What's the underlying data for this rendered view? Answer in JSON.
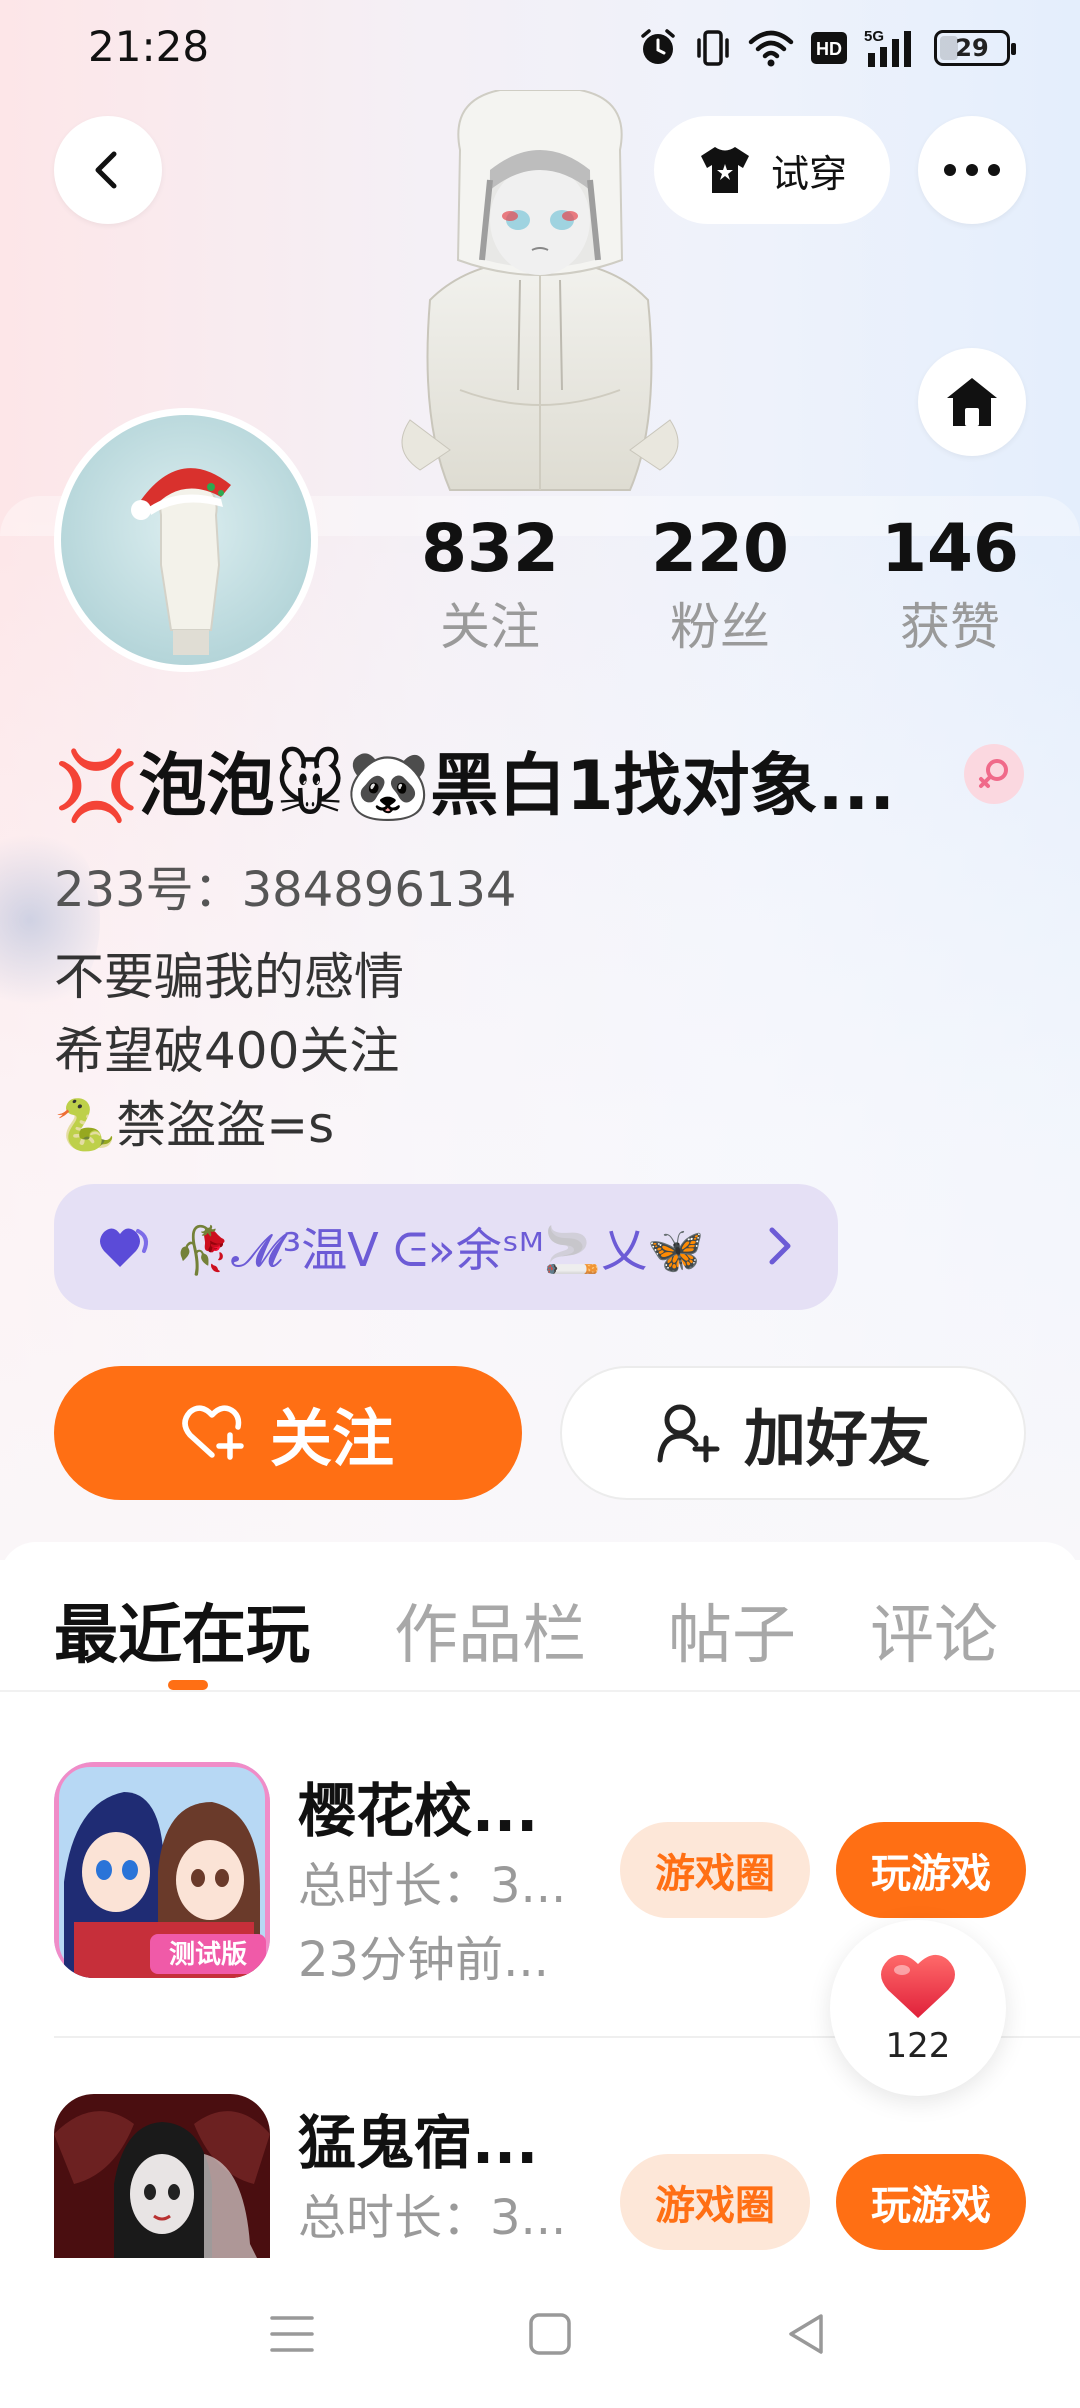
{
  "status_bar": {
    "time": "21:28",
    "battery": "29",
    "network": "5G",
    "hd_label": "HD",
    "icons": [
      "alarm-icon",
      "vibrate-icon",
      "wifi-icon",
      "hd-icon",
      "signal-icon",
      "battery-icon"
    ]
  },
  "header": {
    "try_on_label": "试穿",
    "back_icon": "back-arrow-icon",
    "more_icon": "more-dots-icon",
    "home_icon": "home-icon"
  },
  "stats": [
    {
      "value": "832",
      "label": "关注"
    },
    {
      "value": "220",
      "label": "粉丝"
    },
    {
      "value": "146",
      "label": "获赞"
    }
  ],
  "profile": {
    "nickname": "💢泡泡🐭🐼黑白1找对象...",
    "gender": "female",
    "uid": "233号：384896134",
    "bio_lines": [
      "不要骗我的感情",
      "希望破400关注",
      "🐍禁盗盗=s"
    ],
    "tag_text": "🥀𝓜³温ᐯ ᕮ»余ˢᴹ🚬乂🦋",
    "tag_icon": "heart-icon"
  },
  "actions": {
    "follow_label": "关注",
    "add_friend_label": "加好友"
  },
  "tabs": {
    "recent": "最近在玩",
    "works": "作品栏",
    "posts": "帖子",
    "comments": "评论",
    "active_index": 0
  },
  "games": [
    {
      "title": "樱花校...",
      "duration": "总时长：3...",
      "last_played": "23分钟前...",
      "circle_label": "游戏圈",
      "play_label": "玩游戏",
      "icon_badge": "测试版"
    },
    {
      "title": "猛鬼宿...",
      "duration": "总时长：3...",
      "circle_label": "游戏圈",
      "play_label": "玩游戏"
    }
  ],
  "like_float": {
    "count": "122"
  },
  "colors": {
    "accent": "#ff6f14",
    "accent_light": "#fde7d8",
    "tag_bg": "#e5e0f5",
    "tag_text": "#6c5bd6",
    "muted": "#9a9a9a"
  }
}
